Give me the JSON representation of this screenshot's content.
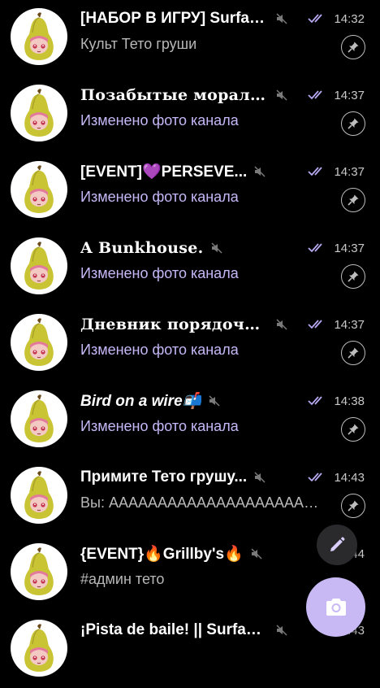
{
  "colors": {
    "background": "#000000",
    "accent": "#c6b8f7",
    "fab_large": "#c8b9f5",
    "fab_small": "#2a2a2d"
  },
  "chats": [
    {
      "title": "[НАБОР В ИГРУ] Surface...",
      "time": "14:32",
      "subtitle": "Культ Тето груши"
    },
    {
      "title": "Позабытые моралу...",
      "time": "14:37",
      "subtitle": "Изменено фото канала"
    },
    {
      "title": "[EVENT]💜PERSEVE...",
      "time": "14:37",
      "subtitle": "Изменено фото канала"
    },
    {
      "title": "A Bunkhouse.",
      "time": "14:37",
      "subtitle": "Изменено фото канала"
    },
    {
      "title": "Дневник порядочн...",
      "time": "14:37",
      "subtitle": "Изменено фото канала"
    },
    {
      "title": "Bird on a wire📬",
      "time": "14:38",
      "subtitle": "Изменено фото канала"
    },
    {
      "title": "Примите Тето грушу...",
      "time": "14:43",
      "subtitle": "Вы: АААААААААААААААААААААА..."
    },
    {
      "title": "{EVENT}🔥Grillby's🔥",
      "time": "14:44",
      "subtitle": "#админ  тето"
    },
    {
      "title": "¡Pista de baile! || Surface...",
      "time": "14:43",
      "subtitle": ""
    }
  ],
  "icons": {
    "mute": "muted-speaker-icon",
    "read": "double-check-icon",
    "pin": "pin-icon",
    "compose": "pencil-icon",
    "camera": "camera-icon",
    "avatar": "pear-avatar"
  }
}
